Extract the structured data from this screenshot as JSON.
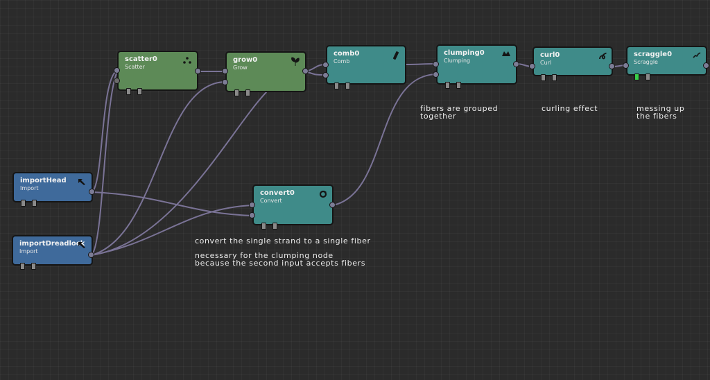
{
  "nodes": {
    "scatter": {
      "title": "scatter0",
      "type": "Scatter"
    },
    "grow": {
      "title": "grow0",
      "type": "Grow"
    },
    "comb": {
      "title": "comb0",
      "type": "Comb"
    },
    "clumping": {
      "title": "clumping0",
      "type": "Clumping"
    },
    "curl": {
      "title": "curl0",
      "type": "Curl"
    },
    "scraggle": {
      "title": "scraggle0",
      "type": "Scraggle"
    },
    "importHead": {
      "title": "importHead",
      "type": "Import"
    },
    "importDreadlock": {
      "title": "importDreadlock",
      "type": "Import"
    },
    "convert": {
      "title": "convert0",
      "type": "Convert"
    }
  },
  "notes": {
    "clumping_line1": "fibers are grouped",
    "clumping_line2": "together",
    "curl_line1": "curling effect",
    "scraggle_line1": "messing up",
    "scraggle_line2": "the fibers",
    "convert_line1": "convert the single strand to a single fiber",
    "convert_line2": "necessary for the clumping node",
    "convert_line3": "because the second input accepts fibers"
  },
  "colors": {
    "background": "#2b2b2b",
    "node_green": "#5d8a57",
    "node_teal": "#3f8b89",
    "node_blue": "#3f6a9b",
    "wire": "#7a7396",
    "display_flag_on": "#38d04a"
  },
  "icons": {
    "scatter": "dots-icon",
    "grow": "leaf-icon",
    "comb": "comb-icon",
    "clumping": "clump-icon",
    "curl": "curl-icon",
    "scraggle": "scraggle-icon",
    "importHead": "import-arrow-icon",
    "importDreadlock": "import-arrow-icon",
    "convert": "convert-cycle-icon"
  }
}
